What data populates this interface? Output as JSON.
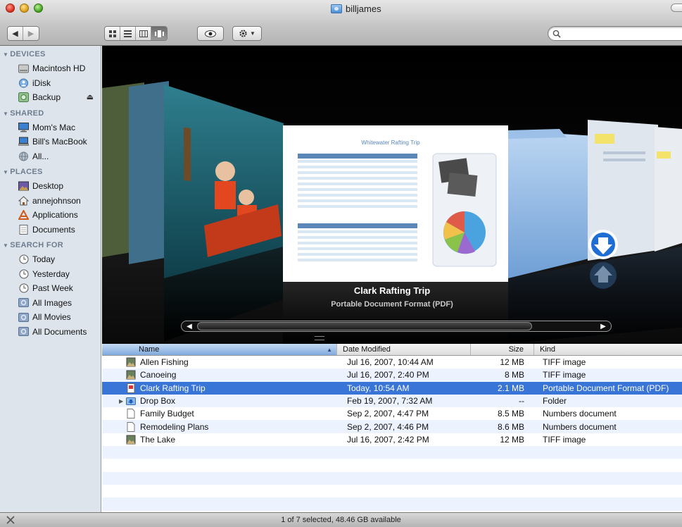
{
  "window": {
    "title": "billjames"
  },
  "toolbar": {
    "back_icon": "back-arrow-icon",
    "forward_icon": "forward-arrow-icon",
    "view_modes": [
      "icon-view-icon",
      "list-view-icon",
      "column-view-icon",
      "coverflow-view-icon"
    ],
    "active_view": "coverflow",
    "quicklook_icon": "eye-icon",
    "action_icon": "gear-icon",
    "search": {
      "value": "",
      "placeholder": ""
    }
  },
  "sidebar": {
    "sections": [
      {
        "heading": "DEVICES",
        "items": [
          {
            "label": "Macintosh HD",
            "icon": "hard-drive-icon"
          },
          {
            "label": "iDisk",
            "icon": "idisk-icon"
          },
          {
            "label": "Backup",
            "icon": "external-drive-icon",
            "eject": true
          }
        ]
      },
      {
        "heading": "SHARED",
        "items": [
          {
            "label": "Mom's Mac",
            "icon": "computer-icon"
          },
          {
            "label": "Bill's MacBook",
            "icon": "computer-icon"
          },
          {
            "label": "All...",
            "icon": "network-icon"
          }
        ]
      },
      {
        "heading": "PLACES",
        "items": [
          {
            "label": "Desktop",
            "icon": "desktop-icon"
          },
          {
            "label": "annejohnson",
            "icon": "home-icon"
          },
          {
            "label": "Applications",
            "icon": "applications-icon"
          },
          {
            "label": "Documents",
            "icon": "documents-icon"
          }
        ]
      },
      {
        "heading": "SEARCH FOR",
        "items": [
          {
            "label": "Today",
            "icon": "clock-icon"
          },
          {
            "label": "Yesterday",
            "icon": "clock-icon"
          },
          {
            "label": "Past Week",
            "icon": "clock-icon"
          },
          {
            "label": "All Images",
            "icon": "smart-folder-icon"
          },
          {
            "label": "All Movies",
            "icon": "smart-folder-icon"
          },
          {
            "label": "All Documents",
            "icon": "smart-folder-icon"
          }
        ]
      }
    ]
  },
  "coverflow": {
    "title": "Clark Rafting Trip",
    "subtitle": "Portable Document Format (PDF)",
    "preview_doc_title": "Whitewater Rafting Trip",
    "scroll_position": 0.04
  },
  "list": {
    "columns": {
      "name": "Name",
      "date": "Date Modified",
      "size": "Size",
      "kind": "Kind"
    },
    "rows": [
      {
        "name": "Allen Fishing",
        "date": "Jul 16, 2007, 10:44 AM",
        "size": "12 MB",
        "kind": "TIFF image",
        "icon": "tiff-image-icon",
        "selected": false,
        "folder": false
      },
      {
        "name": "Canoeing",
        "date": "Jul 16, 2007, 2:40 PM",
        "size": "8 MB",
        "kind": "TIFF image",
        "icon": "tiff-image-icon",
        "selected": false,
        "folder": false
      },
      {
        "name": "Clark Rafting Trip",
        "date": "Today, 10:54 AM",
        "size": "2.1 MB",
        "kind": "Portable Document Format (PDF)",
        "icon": "pdf-document-icon",
        "selected": true,
        "folder": false
      },
      {
        "name": "Drop Box",
        "date": "Feb 19, 2007, 7:32 AM",
        "size": "--",
        "kind": "Folder",
        "icon": "dropbox-folder-icon",
        "selected": false,
        "folder": true
      },
      {
        "name": "Family Budget",
        "date": "Sep 2, 2007, 4:47 PM",
        "size": "8.5 MB",
        "kind": "Numbers document",
        "icon": "document-icon",
        "selected": false,
        "folder": false
      },
      {
        "name": "Remodeling Plans",
        "date": "Sep 2, 2007, 4:46 PM",
        "size": "8.6 MB",
        "kind": "Numbers document",
        "icon": "document-icon",
        "selected": false,
        "folder": false
      },
      {
        "name": "The Lake",
        "date": "Jul 16, 2007, 2:42 PM",
        "size": "12 MB",
        "kind": "TIFF image",
        "icon": "tiff-image-icon",
        "selected": false,
        "folder": false
      }
    ],
    "empty_rows": 5
  },
  "status": {
    "text": "1 of 7 selected, 48.46 GB available",
    "icon": "tools-icon"
  },
  "colors": {
    "selection": "#3875d7",
    "sidebar_bg": "#dde4ec",
    "sidebar_heading": "#6d7d90",
    "stripe": "#edf3fe"
  }
}
